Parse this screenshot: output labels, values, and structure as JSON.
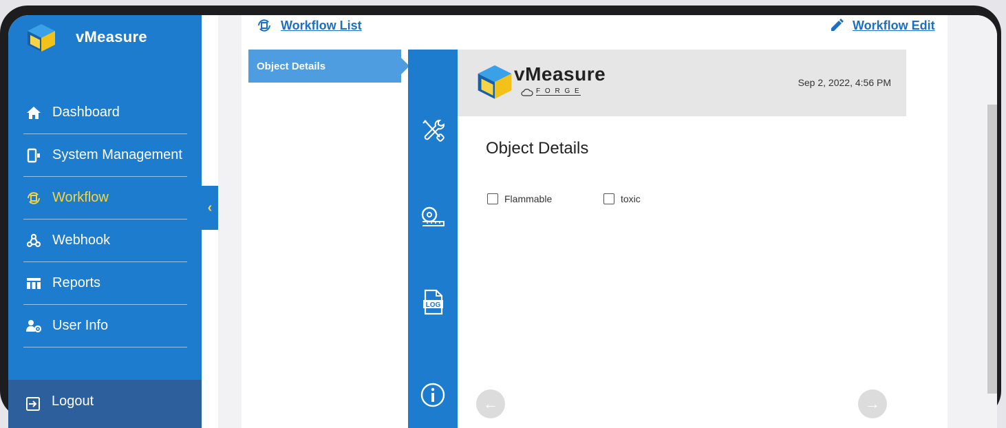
{
  "app": {
    "brand": "vMeasure"
  },
  "sidebar": {
    "items": [
      {
        "label": "Dashboard",
        "icon": "home-icon",
        "active": false
      },
      {
        "label": "System Management",
        "icon": "device-icon",
        "active": false
      },
      {
        "label": "Workflow",
        "icon": "workflow-icon",
        "active": true
      },
      {
        "label": "Webhook",
        "icon": "webhook-icon",
        "active": false
      },
      {
        "label": "Reports",
        "icon": "table-icon",
        "active": false
      },
      {
        "label": "User Info",
        "icon": "user-gear-icon",
        "active": false
      }
    ],
    "logout": "Logout",
    "collapse_glyph": "‹"
  },
  "topbar": {
    "workflow_list": "Workflow List",
    "workflow_edit": "Workflow Edit"
  },
  "steps": [
    {
      "label": "Object Details",
      "active": true
    }
  ],
  "tools": [
    "tools-icon",
    "tape-measure-icon",
    "log-file-icon",
    "info-icon"
  ],
  "card": {
    "logo_name": "vMeasure",
    "logo_sub": "F O R G E",
    "date": "Sep 2, 2022, 4:56 PM",
    "title": "Object Details",
    "checkboxes": [
      {
        "label": "Flammable",
        "checked": false
      },
      {
        "label": "toxic",
        "checked": false
      }
    ]
  },
  "colors": {
    "primary": "#1d7ccd",
    "accent": "#f5d547",
    "link": "#1d6fc2",
    "logout_bg": "#2c5f9c"
  }
}
